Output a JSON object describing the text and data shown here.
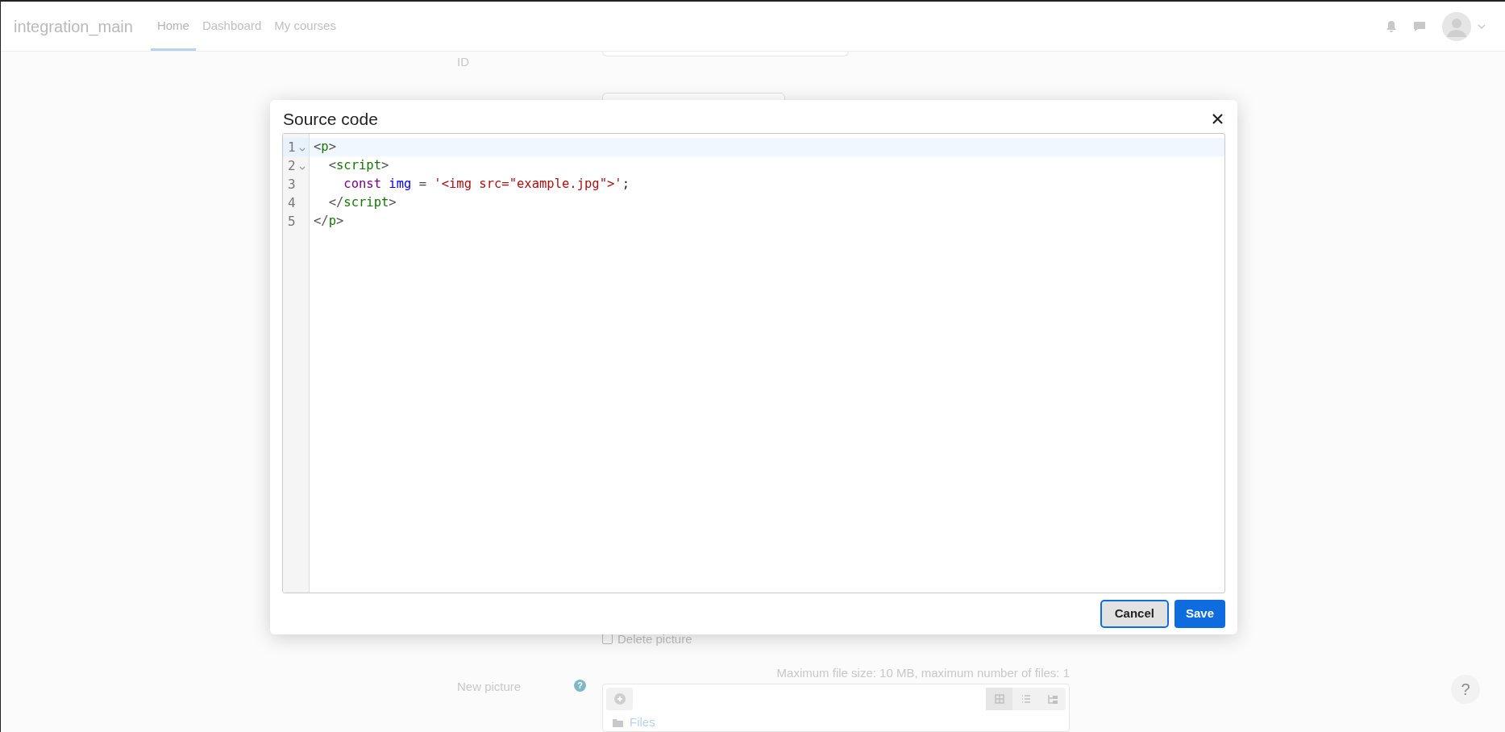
{
  "navbar": {
    "brand": "integration_main",
    "links": [
      {
        "label": "Home",
        "selected": true
      },
      {
        "label": "Dashboard",
        "selected": false
      },
      {
        "label": "My courses",
        "selected": false
      }
    ]
  },
  "form": {
    "id_label": "ID",
    "delete_picture": {
      "label": "Delete picture",
      "checked": false
    },
    "new_picture_label": "New picture",
    "file_limits": "Maximum file size: 10 MB, maximum number of files: 1",
    "folder": "Files",
    "help_glyph": "?"
  },
  "help_button": "?",
  "dialog": {
    "title": "Source code",
    "lines": [
      {
        "number": "1",
        "fold": true,
        "selected": true,
        "tokens": [
          {
            "kind": "bracket",
            "text": "<"
          },
          {
            "kind": "tag",
            "text": "p"
          },
          {
            "kind": "bracket",
            "text": ">"
          }
        ]
      },
      {
        "number": "2",
        "fold": true,
        "selected": false,
        "tokens": [
          {
            "kind": "bracket",
            "text": "  <"
          },
          {
            "kind": "tag",
            "text": "script"
          },
          {
            "kind": "bracket",
            "text": ">"
          }
        ]
      },
      {
        "number": "3",
        "fold": false,
        "selected": false,
        "tokens": [
          {
            "kind": "keyword",
            "text": "    const"
          },
          {
            "kind": "def",
            "text": " img"
          },
          {
            "kind": "operator",
            "text": " = "
          },
          {
            "kind": "string",
            "text": "'<img src=\"example.jpg\">'"
          },
          {
            "kind": "plain",
            "text": ";"
          }
        ]
      },
      {
        "number": "4",
        "fold": false,
        "selected": false,
        "tokens": [
          {
            "kind": "bracket",
            "text": "  </"
          },
          {
            "kind": "tag",
            "text": "script"
          },
          {
            "kind": "bracket",
            "text": ">"
          }
        ]
      },
      {
        "number": "5",
        "fold": false,
        "selected": false,
        "tokens": [
          {
            "kind": "bracket",
            "text": "</"
          },
          {
            "kind": "tag",
            "text": "p"
          },
          {
            "kind": "bracket",
            "text": ">"
          }
        ]
      }
    ],
    "buttons": [
      {
        "label": "Cancel",
        "kind": "secondary"
      },
      {
        "label": "Save",
        "kind": "primary"
      }
    ]
  }
}
